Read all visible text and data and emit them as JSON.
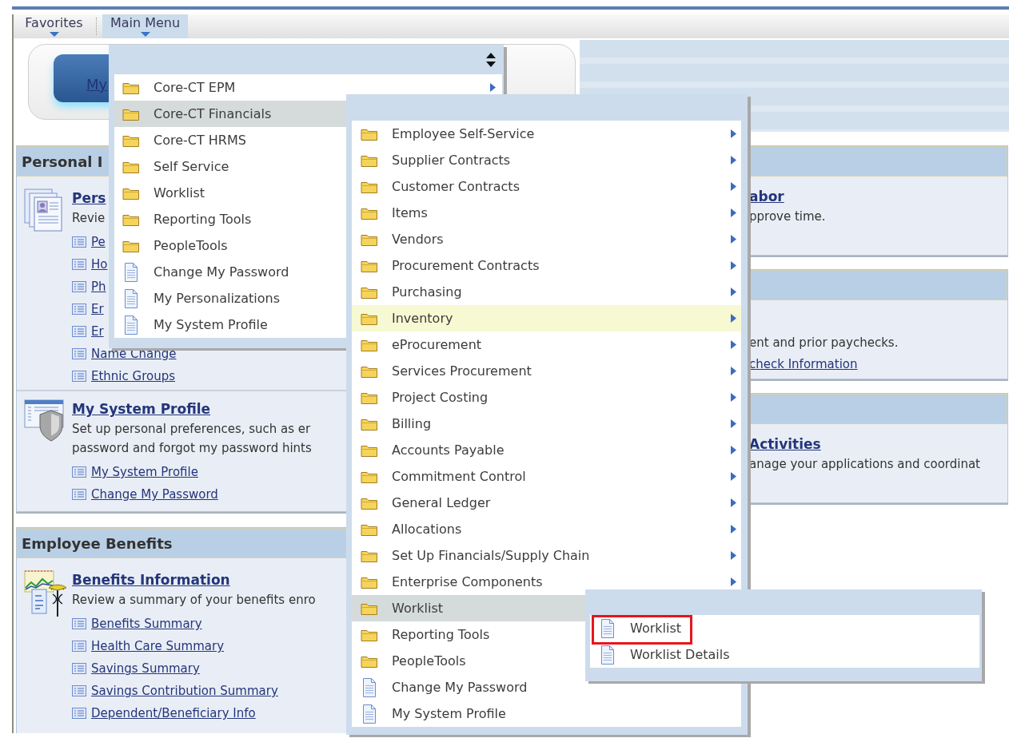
{
  "menubar": {
    "items": [
      {
        "label": "Favorites",
        "selected": false
      },
      {
        "label": "Main Menu",
        "selected": true
      }
    ]
  },
  "header": {
    "button_label": "My"
  },
  "left_panels": [
    {
      "title": "Personal I",
      "sections": [
        {
          "kind": "personal",
          "title": "Pers",
          "description": "Revie",
          "links": [
            "Pe",
            "Ho",
            "Ph",
            "Er",
            "Er",
            "Name Change",
            "Ethnic Groups"
          ]
        },
        {
          "kind": "profile",
          "title": "My System Profile",
          "description": "Set up personal preferences, such as er\npassword and forgot my password hints",
          "links": [
            "My System Profile",
            "Change My Password"
          ]
        }
      ]
    },
    {
      "title": "Employee Benefits",
      "sections": [
        {
          "kind": "benefits",
          "title": "Benefits Information",
          "description": "Review a summary of your benefits enro",
          "links": [
            "Benefits Summary",
            "Health Care Summary",
            "Savings Summary",
            "Savings Contribution Summary",
            "Dependent/Beneficiary Info"
          ]
        }
      ]
    }
  ],
  "right_panels": [
    {
      "title": "abor",
      "description": "pprove time."
    },
    {
      "description": "ent and prior paychecks.",
      "links": [
        "check Information"
      ]
    },
    {
      "title": "Activities",
      "description": "anage your applications and coordinat"
    }
  ],
  "menus": [
    {
      "sort_icon": true,
      "items": [
        {
          "label": "Core-CT EPM",
          "kind": "folder",
          "selected": false,
          "hovered": false,
          "arrow": true
        },
        {
          "label": "Core-CT Financials",
          "kind": "folder",
          "selected": true,
          "hovered": false
        },
        {
          "label": "Core-CT HRMS",
          "kind": "folder",
          "selected": false,
          "hovered": false
        },
        {
          "label": "Self Service",
          "kind": "folder",
          "selected": false,
          "hovered": false
        },
        {
          "label": "Worklist",
          "kind": "folder",
          "selected": false,
          "hovered": false
        },
        {
          "label": "Reporting Tools",
          "kind": "folder",
          "selected": false,
          "hovered": false
        },
        {
          "label": "PeopleTools",
          "kind": "folder",
          "selected": false,
          "hovered": false
        },
        {
          "label": "Change My Password",
          "kind": "page",
          "selected": false,
          "hovered": false
        },
        {
          "label": "My Personalizations",
          "kind": "page",
          "selected": false,
          "hovered": false
        },
        {
          "label": "My System Profile",
          "kind": "page",
          "selected": false,
          "hovered": false
        }
      ]
    },
    {
      "items": [
        {
          "label": "Employee Self-Service",
          "kind": "folder",
          "selected": false,
          "hovered": false,
          "arrow": true
        },
        {
          "label": "Supplier Contracts",
          "kind": "folder",
          "selected": false,
          "hovered": false,
          "arrow": true
        },
        {
          "label": "Customer Contracts",
          "kind": "folder",
          "selected": false,
          "hovered": false,
          "arrow": true
        },
        {
          "label": "Items",
          "kind": "folder",
          "selected": false,
          "hovered": false,
          "arrow": true
        },
        {
          "label": "Vendors",
          "kind": "folder",
          "selected": false,
          "hovered": false,
          "arrow": true
        },
        {
          "label": "Procurement Contracts",
          "kind": "folder",
          "selected": false,
          "hovered": false,
          "arrow": true
        },
        {
          "label": "Purchasing",
          "kind": "folder",
          "selected": false,
          "hovered": false,
          "arrow": true
        },
        {
          "label": "Inventory",
          "kind": "folder",
          "selected": false,
          "hovered": true,
          "arrow": true
        },
        {
          "label": "eProcurement",
          "kind": "folder",
          "selected": false,
          "hovered": false,
          "arrow": true
        },
        {
          "label": "Services Procurement",
          "kind": "folder",
          "selected": false,
          "hovered": false,
          "arrow": true
        },
        {
          "label": "Project Costing",
          "kind": "folder",
          "selected": false,
          "hovered": false,
          "arrow": true
        },
        {
          "label": "Billing",
          "kind": "folder",
          "selected": false,
          "hovered": false,
          "arrow": true
        },
        {
          "label": "Accounts Payable",
          "kind": "folder",
          "selected": false,
          "hovered": false,
          "arrow": true
        },
        {
          "label": "Commitment Control",
          "kind": "folder",
          "selected": false,
          "hovered": false,
          "arrow": true
        },
        {
          "label": "General Ledger",
          "kind": "folder",
          "selected": false,
          "hovered": false,
          "arrow": true
        },
        {
          "label": "Allocations",
          "kind": "folder",
          "selected": false,
          "hovered": false,
          "arrow": true
        },
        {
          "label": "Set Up Financials/Supply Chain",
          "kind": "folder",
          "selected": false,
          "hovered": false,
          "arrow": true
        },
        {
          "label": "Enterprise Components",
          "kind": "folder",
          "selected": false,
          "hovered": false,
          "arrow": true
        },
        {
          "label": "Worklist",
          "kind": "folder",
          "selected": true,
          "hovered": false
        },
        {
          "label": "Reporting Tools",
          "kind": "folder",
          "selected": false,
          "hovered": false
        },
        {
          "label": "PeopleTools",
          "kind": "folder",
          "selected": false,
          "hovered": false
        },
        {
          "label": "Change My Password",
          "kind": "page",
          "selected": false,
          "hovered": false
        },
        {
          "label": "My System Profile",
          "kind": "page",
          "selected": false,
          "hovered": false
        }
      ]
    },
    {
      "items": [
        {
          "label": "Worklist",
          "kind": "page",
          "selected": false,
          "hovered": false,
          "marked": true
        },
        {
          "label": "Worklist Details",
          "kind": "page",
          "selected": false,
          "hovered": false
        }
      ]
    }
  ]
}
